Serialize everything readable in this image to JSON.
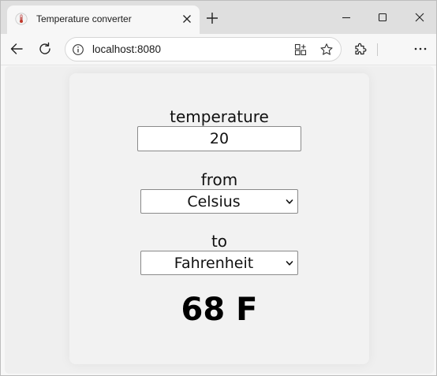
{
  "browser": {
    "tab_title": "Temperature converter",
    "url": "localhost:8080"
  },
  "icons": {
    "favicon": "thermometer-icon",
    "tab_close": "close-icon",
    "new_tab": "plus-icon",
    "minimize": "minimize-icon",
    "maximize": "maximize-icon",
    "close": "close-icon",
    "back": "back-arrow-icon",
    "reload": "reload-icon",
    "site_info": "info-icon",
    "app_available": "app-available-icon",
    "favorite": "star-icon",
    "extensions": "puzzle-icon",
    "more": "more-icon"
  },
  "converter": {
    "temperature_label": "temperature",
    "temperature_value": "20",
    "from_label": "from",
    "from_selected": "Celsius",
    "to_label": "to",
    "to_selected": "Fahrenheit",
    "result": "68 F"
  }
}
